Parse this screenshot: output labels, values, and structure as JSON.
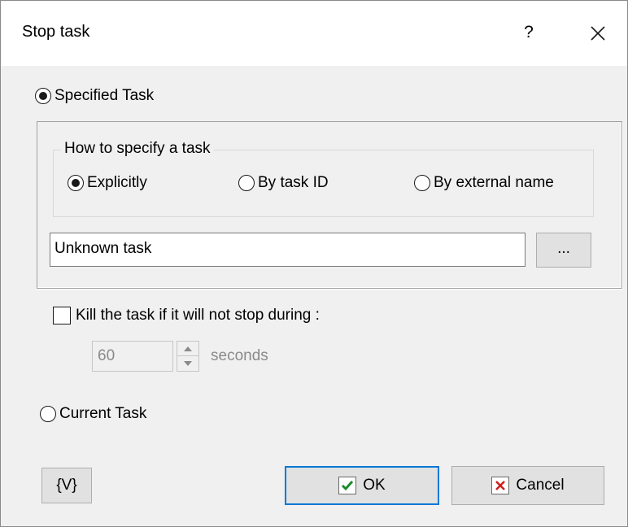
{
  "window": {
    "title": "Stop task",
    "help_label": "?"
  },
  "specified_task": {
    "label": "Specified Task",
    "selected": true
  },
  "how_to_specify": {
    "group_title": "How to specify a task",
    "options": [
      {
        "label": "Explicitly",
        "selected": true
      },
      {
        "label": "By task ID",
        "selected": false
      },
      {
        "label": "By external name",
        "selected": false
      }
    ]
  },
  "task_field": {
    "value": "Unknown task",
    "browse_label": "..."
  },
  "kill_option": {
    "label": "Kill the task if it will not stop during :",
    "checked": false,
    "timeout_value": "60",
    "unit_label": "seconds"
  },
  "current_task": {
    "label": "Current Task",
    "selected": false
  },
  "buttons": {
    "variables_label": "{V}",
    "ok_label": "OK",
    "cancel_label": "Cancel"
  },
  "colors": {
    "accent": "#0078d7",
    "ok_check": "#1a8a2a",
    "cancel_x": "#d21e1e"
  },
  "icons": [
    "close-icon",
    "ok-check-icon",
    "cancel-x-icon",
    "spin-up-icon",
    "spin-down-icon"
  ]
}
